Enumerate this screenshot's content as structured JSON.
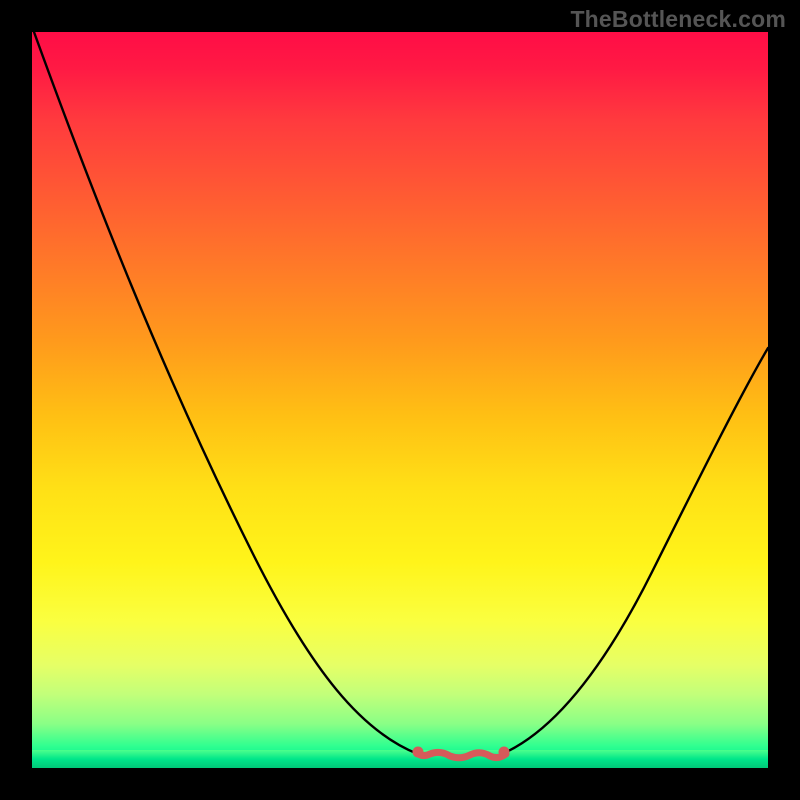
{
  "watermark": "TheBottleneck.com",
  "chart_data": {
    "type": "line",
    "title": "",
    "xlabel": "",
    "ylabel": "",
    "xlim": [
      0,
      100
    ],
    "ylim": [
      0,
      100
    ],
    "grid": false,
    "legend": false,
    "series": [
      {
        "name": "bottleneck-curve",
        "x": [
          0,
          10,
          20,
          30,
          40,
          45,
          50,
          55,
          60,
          65,
          70,
          80,
          90,
          100
        ],
        "values": [
          98,
          80,
          62,
          44,
          25,
          14,
          6,
          1,
          0,
          0,
          4,
          18,
          36,
          56
        ]
      }
    ],
    "trough": {
      "x_start": 53,
      "x_end": 66,
      "value": 0
    },
    "gradient_stops": [
      {
        "pos": 0,
        "color": "#ff0d46"
      },
      {
        "pos": 50,
        "color": "#ffc018"
      },
      {
        "pos": 80,
        "color": "#faff40"
      },
      {
        "pos": 100,
        "color": "#00e08c"
      }
    ]
  }
}
